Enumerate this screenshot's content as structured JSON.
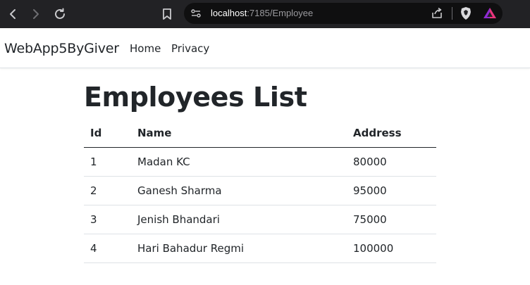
{
  "browser": {
    "url_host": "localhost",
    "url_rest": ":7185/Employee"
  },
  "navbar": {
    "brand": "WebApp5ByGiver",
    "links": [
      "Home",
      "Privacy"
    ]
  },
  "page": {
    "title": "Employees List"
  },
  "table": {
    "columns": [
      "Id",
      "Name",
      "Address"
    ],
    "rows": [
      [
        "1",
        "Madan KC",
        "80000"
      ],
      [
        "2",
        "Ganesh Sharma",
        "95000"
      ],
      [
        "3",
        "Jenish Bhandari",
        "75000"
      ],
      [
        "4",
        "Hari Bahadur Regmi",
        "100000"
      ]
    ]
  },
  "colors": {
    "chrome_bg": "#222225",
    "urlbar_bg": "#0f0f10",
    "text": "#212529",
    "row_border": "#dee2e6"
  }
}
